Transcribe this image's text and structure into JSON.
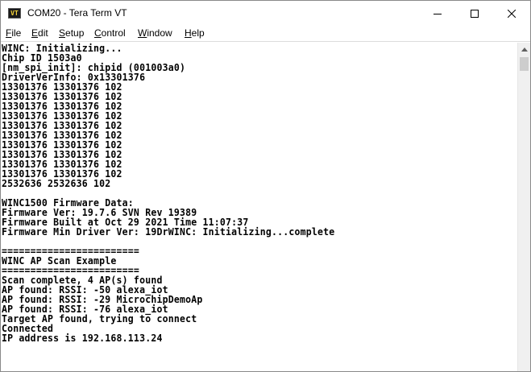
{
  "window": {
    "title": "COM20 - Tera Term VT",
    "icon_text": "VT"
  },
  "menu": [
    {
      "mnemonic": "F",
      "rest": "ile"
    },
    {
      "mnemonic": "E",
      "rest": "dit"
    },
    {
      "mnemonic": "S",
      "rest": "etup"
    },
    {
      "mnemonic": "C",
      "rest": "ontrol"
    },
    {
      "mnemonic": "W",
      "rest": "indow"
    },
    {
      "mnemonic": "H",
      "rest": "elp"
    }
  ],
  "terminal": {
    "lines": [
      "WINC: Initializing...",
      "Chip ID 1503a0",
      "[nm_spi_init]: chipid (001003a0)",
      "DriverVerInfo: 0x13301376",
      "13301376 13301376 102",
      "13301376 13301376 102",
      "13301376 13301376 102",
      "13301376 13301376 102",
      "13301376 13301376 102",
      "13301376 13301376 102",
      "13301376 13301376 102",
      "13301376 13301376 102",
      "13301376 13301376 102",
      "13301376 13301376 102",
      "2532636 2532636 102",
      "",
      "WINC1500 Firmware Data:",
      "Firmware Ver: 19.7.6 SVN Rev 19389",
      "Firmware Built at Oct 29 2021 Time 11:07:37",
      "Firmware Min Driver Ver: 19DrWINC: Initializing...complete",
      "",
      "========================",
      "WINC AP Scan Example",
      "========================",
      "Scan complete, 4 AP(s) found",
      "AP found: RSSI: -50 alexa_iot",
      "AP found: RSSI: -29 MicrochipDemoAp",
      "AP found: RSSI: -76 alexa_iot",
      "Target AP found, trying to connect",
      "Connected",
      "IP address is 192.168.113.24"
    ]
  }
}
